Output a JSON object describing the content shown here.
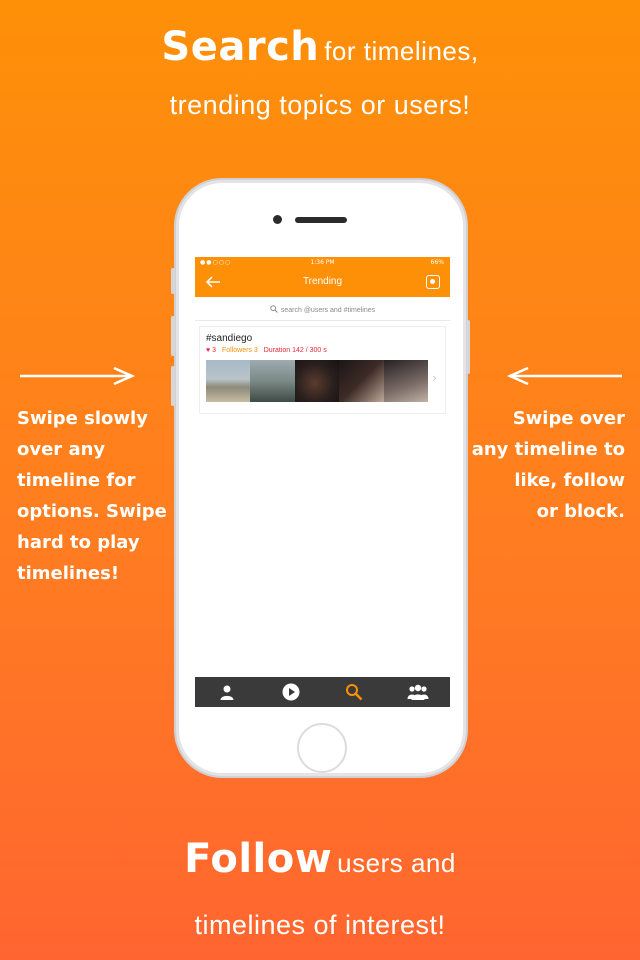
{
  "headline_top": {
    "line1_bold": "Search",
    "line1_rest": "for timelines,",
    "line2": "trending topics or users!"
  },
  "headline_bottom": {
    "line1_bold": "Follow",
    "line1_rest": "users and",
    "line2": "timelines of interest!"
  },
  "left_caption": [
    "Swipe slowly",
    "over any",
    "timeline for",
    "options. Swipe",
    "hard to play",
    "timelines!"
  ],
  "right_caption": [
    "Swipe over",
    "any timeline to",
    "like, follow",
    "or block."
  ],
  "app": {
    "status": {
      "signal": "●●○○○",
      "time": "1:36 PM",
      "battery": "66%"
    },
    "nav": {
      "title": "Trending",
      "back_icon": "back-arrow-icon",
      "action_icon": "camera-icon"
    },
    "search": {
      "placeholder": "search @users and #timelines"
    },
    "timeline": {
      "tag": "#sandiego",
      "likes": "3",
      "followers": "Followers 3",
      "duration": "Duration  142 / 300 s"
    },
    "tabs": [
      "profile-icon",
      "play-icon",
      "search-icon",
      "group-icon"
    ],
    "active_tab_color": "#fe9008",
    "accent": "#fe9008"
  }
}
